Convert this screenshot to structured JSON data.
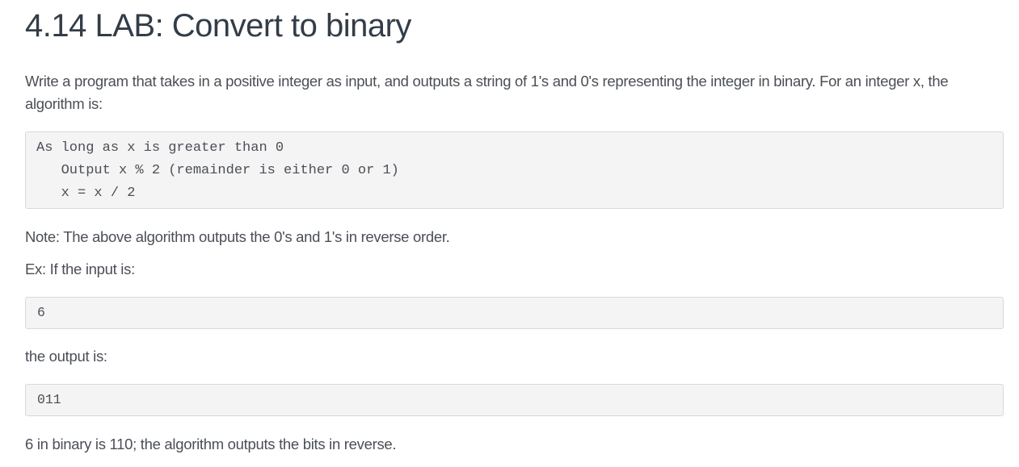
{
  "page": {
    "title": "4.14 LAB: Convert to binary",
    "intro": "Write a program that takes in a positive integer as input, and outputs a string of 1's and 0's representing the integer in binary. For an integer x, the algorithm is:",
    "algorithm_lines": [
      "As long as x is greater than 0",
      "   Output x % 2 (remainder is either 0 or 1)",
      "   x = x / 2"
    ],
    "note": "Note: The above algorithm outputs the 0's and 1's in reverse order.",
    "example_intro": "Ex: If the input is:",
    "example_input": "6",
    "output_label": "the output is:",
    "example_output": "011",
    "explanation": "6 in binary is 110; the algorithm outputs the bits in reverse."
  }
}
